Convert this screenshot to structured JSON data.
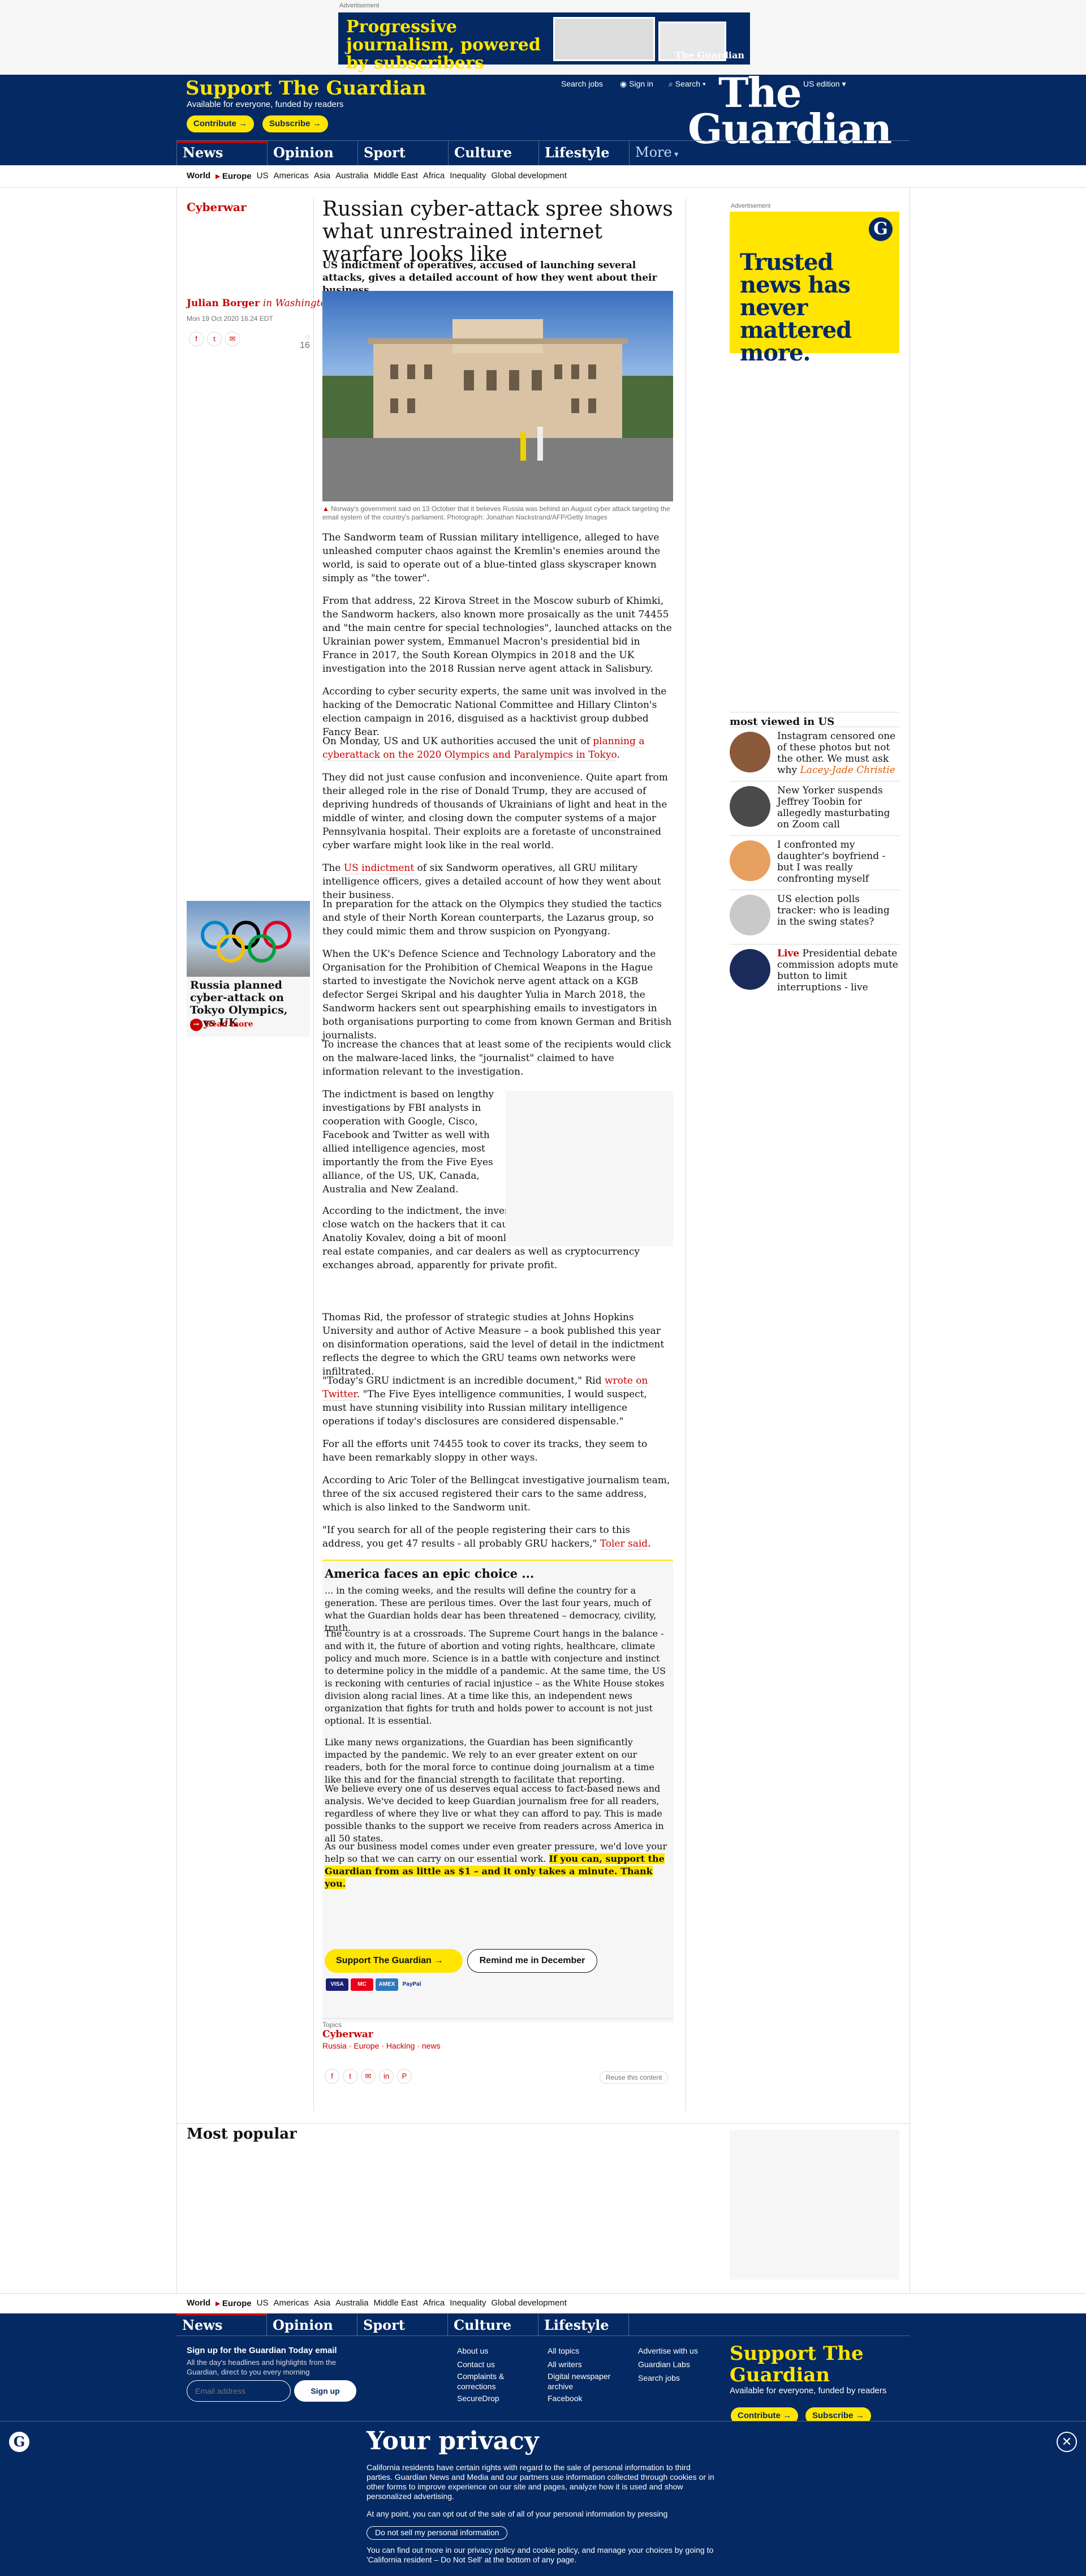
{
  "ad_top": {
    "label": "Advertisement",
    "text": "Progressive journalism, powered by subscribers",
    "logo": "The Guardian"
  },
  "header": {
    "support_title": "Support The Guardian",
    "support_sub": "Available for everyone, funded by readers",
    "contribute": "Contribute →",
    "subscribe": "Subscribe →",
    "search_jobs": "Search jobs",
    "sign_in": "Sign in",
    "search": "Search",
    "edition": "US edition",
    "brand_1": "The",
    "brand_2": "Guardian"
  },
  "nav": [
    {
      "label": "News",
      "color": "#c70000"
    },
    {
      "label": "Opinion",
      "color": "#e05e00"
    },
    {
      "label": "Sport",
      "color": "#0084c6"
    },
    {
      "label": "Culture",
      "color": "#a1845c"
    },
    {
      "label": "Lifestyle",
      "color": "#bb3b80"
    },
    {
      "label": "More"
    }
  ],
  "subnav": [
    "World",
    "Europe",
    "US",
    "Americas",
    "Asia",
    "Australia",
    "Middle East",
    "Africa",
    "Inequality",
    "Global development"
  ],
  "article": {
    "section": "Cyberwar",
    "headline": "Russian cyber-attack spree shows what unrestrained internet warfare looks like",
    "standfirst": "US indictment of operatives, accused of launching several attacks, gives a detailed account of how they went about their business",
    "author": "Julian Borger",
    "author_loc": "in Washington",
    "date": "Mon 19 Oct 2020 16.24 EDT",
    "comments": "16",
    "caption": "Norway's government said on 13 October that it believes Russia was behind an August cyber attack targeting the email system of the country's parliament. Photograph: Jonathan Nackstrand/AFP/Getty Images",
    "p1": "The Sandworm team of Russian military intelligence, alleged to have unleashed computer chaos against the Kremlin's enemies around the world, is said to operate out of a blue-tinted glass skyscraper known simply as \"the tower\".",
    "p2": "From that address, 22 Kirova Street in the Moscow suburb of Khimki, the Sandworm hackers, also known more prosaically as the unit 74455 and \"the main centre for special technologies\", launched attacks on the Ukrainian power system, Emmanuel Macron's presidential bid in France in 2017, the South Korean Olympics in 2018 and the UK investigation into the 2018 Russian nerve agent attack in Salisbury.",
    "p3": "According to cyber security experts, the same unit was involved in the hacking of the Democratic National Committee and Hillary Clinton's election campaign in 2016, disguised as a hacktivist group dubbed Fancy Bear.",
    "p4a": "On Monday, US and UK authorities accused the unit of ",
    "p4link": "planning a cyberattack on the 2020 Olympics and Paralympics in Tokyo",
    "p4b": ".",
    "p5": "They did not just cause confusion and inconvenience. Quite apart from their alleged role in the rise of Donald Trump, they are accused of depriving hundreds of thousands of Ukrainians of light and heat in the middle of winter, and closing down the computer systems of a major Pennsylvania hospital. Their exploits are a foretaste of unconstrained cyber warfare might look like in the real world.",
    "p6a": "The ",
    "p6link": "US indictment",
    "p6b": " of six Sandworm operatives, all GRU military intelligence officers, gives a detailed account of how they went about their business.",
    "p7": "In preparation for the attack on the Olympics they studied the tactics and style of their North Korean counterparts, the Lazarus group, so they could mimic them and throw suspicion on Pyongyang.",
    "p8": "When the UK's Defence Science and Technology Laboratory and the Organisation for the Prohibition of Chemical Weapons in the Hague started to investigate the Novichok nerve agent attack on a KGB defector Sergei Skripal and his daughter Yulia in March 2018, the Sandworm hackers sent out spearphishing emails to investigators in both organisations purporting to come from known German and British journalists.",
    "p9": "To increase the chances that at least some of the recipients would click on the malware-laced links, the \"journalist\" claimed to have information relevant to the investigation.",
    "p10": "The indictment is based on lengthy investigations by FBI analysts in cooperation with Google, Cisco, Facebook and Twitter as well with allied intelligence agencies, most importantly the from the Five Eyes alliance, of the US, UK, Canada, Australia and New Zealand.",
    "p11": "According to the indictment, the investigators were able to keep such a close watch on the hackers that it caught one of them, named as Anatoliy Kovalev, doing a bit of moonlighting, spearphishing Russian real estate companies, and car dealers as well as cryptocurrency exchanges abroad, apparently for private profit.",
    "p12": "Thomas Rid, the professor of strategic studies at Johns Hopkins University and author of Active Measure – a book published this year on disinformation operations, said the level of detail in the indictment reflects the degree to which the GRU teams own networks were infiltrated.",
    "p13a": "\"Today's GRU indictment is an incredible document,\" Rid ",
    "p13link": "wrote on Twitter",
    "p13b": ". \"The Five Eyes intelligence communities, I would suspect, must have stunning visibility into Russian military intelligence operations if today's disclosures are considered dispensable.\"",
    "p14": "For all the efforts unit 74455 took to cover its tracks, they seem to have been remarkably sloppy in other ways.",
    "p15": "According to Aric Toler of the Bellingcat investigative journalism team, three of the six accused registered their cars to the same address, which is also linked to the Sandworm unit.",
    "p16a": "\"If you search for all of the people registering their cars to this address, you get 47 results - all probably GRU hackers,\" ",
    "p16link": "Toler said",
    "p16b": "."
  },
  "rich_link": {
    "title": "Russia planned cyber-attack on Tokyo Olympics, says UK",
    "more": "Read more"
  },
  "epic": {
    "title": "America faces an epic choice ...",
    "p1": "... in the coming weeks, and the results will define the country for a generation. These are perilous times. Over the last four years, much of what the Guardian holds dear has been threatened – democracy, civility, truth.",
    "p2": "The country is at a crossroads. The Supreme Court hangs in the balance - and with it, the future of abortion and voting rights, healthcare, climate policy and much more. Science is in a battle with conjecture and instinct to determine policy in the middle of a pandemic. At the same time, the US is reckoning with centuries of racial injustice – as the White House stokes division along racial lines. At a time like this, an independent news organization that fights for truth and holds power to account is not just optional. It is essential.",
    "p3": "Like many news organizations, the Guardian has been significantly impacted by the pandemic. We rely to an ever greater extent on our readers, both for the moral force to continue doing journalism at a time like this and for the financial strength to facilitate that reporting.",
    "p4": "We believe every one of us deserves equal access to fact-based news and analysis. We've decided to keep Guardian journalism free for all readers, regardless of where they live or what they can afford to pay. This is made possible thanks to the support we receive from readers across America in all 50 states.",
    "p5a": "As our business model comes under even greater pressure, we'd love your help so that we can carry on our essential work. ",
    "p5b": "If you can, support the Guardian from as little as $1 – and it only takes a minute. Thank you.",
    "btn_support": "Support The Guardian →",
    "btn_remind": "Remind me in December",
    "cards": [
      "VISA",
      "MC",
      "AMEX",
      "PayPal"
    ]
  },
  "topics": {
    "label": "Topics",
    "main": "Cyberwar",
    "tags": "Russia · Europe · Hacking · news",
    "reuse": "Reuse this content"
  },
  "right": {
    "ad_label": "Advertisement",
    "ad_text": "Trusted news has never mattered more.",
    "mv_title": "most viewed in US",
    "items": [
      {
        "text": "Instagram censored one of these photos but not the other. We must ask why",
        "byline": "Lacey-Jade Christie"
      },
      {
        "text": "New Yorker suspends Jeffrey Toobin for allegedly masturbating on Zoom call"
      },
      {
        "text": "I confronted my daughter's boyfriend - but I was really confronting myself"
      },
      {
        "text": "US election polls tracker: who is leading in the swing states?"
      },
      {
        "live": "Live",
        "text": "Presidential debate commission adopts mute button to limit interruptions - live"
      }
    ]
  },
  "most_popular": "Most popular",
  "footer": {
    "subnav": [
      "World",
      "Europe",
      "US",
      "Americas",
      "Asia",
      "Australia",
      "Middle East",
      "Africa",
      "Inequality",
      "Global development"
    ],
    "email_title": "Sign up for the Guardian Today email",
    "email_sub": "All the day's headlines and highlights from the Guardian, direct to you every morning",
    "email_placeholder": "Email address",
    "sign_up": "Sign up",
    "col1": [
      "About us",
      "Contact us",
      "Complaints & corrections",
      "SecureDrop"
    ],
    "col2": [
      "All topics",
      "All writers",
      "Digital newspaper archive",
      "Facebook"
    ],
    "col3": [
      "Advertise with us",
      "Guardian Labs",
      "Search jobs"
    ],
    "support_title": "Support The Guardian",
    "support_sub": "Available for everyone, funded by readers"
  },
  "privacy": {
    "title": "Your privacy",
    "p1": "California residents have certain rights with regard to the sale of personal information to third parties. Guardian News and Media and our partners use information collected through cookies or in other forms to improve experience on our site and pages, analyze how it is used and show personalized advertising.",
    "p2": "At any point, you can opt out of the sale of all of your personal information by pressing",
    "btn": "Do not sell my personal information",
    "p3": "You can find out more in our privacy policy and cookie policy, and manage your choices by going to 'California resident – Do Not Sell' at the bottom of any page.",
    "close": "✕"
  }
}
